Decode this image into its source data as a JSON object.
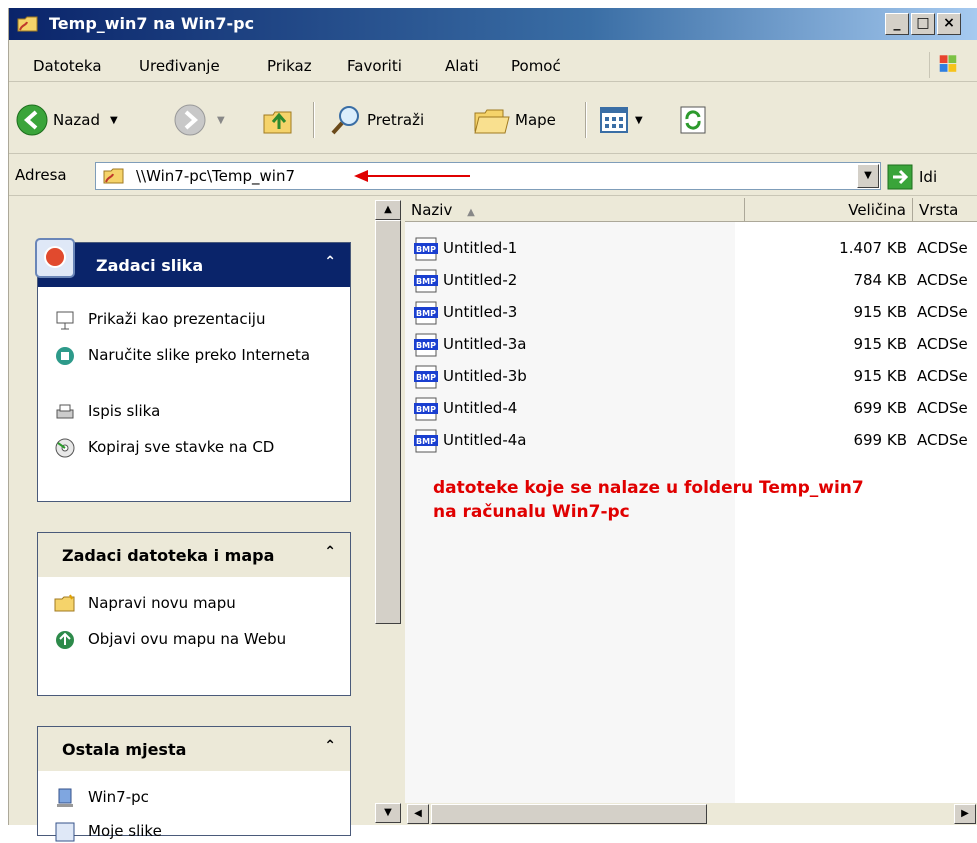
{
  "window": {
    "title": "Temp_win7 na Win7-pc"
  },
  "menu": [
    "Datoteka",
    "Uređivanje",
    "Prikaz",
    "Favoriti",
    "Alati",
    "Pomoć"
  ],
  "toolbar": {
    "back": "Nazad",
    "search": "Pretraži",
    "folders": "Mape"
  },
  "address": {
    "label": "Adresa",
    "value": "\\\\Win7-pc\\Temp_win7",
    "go": "Idi"
  },
  "panels": {
    "picture_tasks": {
      "title": "Zadaci slika",
      "items": [
        "Prikaži kao prezentaciju",
        "Naručite slike preko Interneta",
        "Ispis slika",
        "Kopiraj sve stavke na CD"
      ]
    },
    "file_tasks": {
      "title": "Zadaci datoteka i mapa",
      "items": [
        "Napravi novu mapu",
        "Objavi ovu mapu na Webu"
      ]
    },
    "other_places": {
      "title": "Ostala mjesta",
      "items": [
        "Win7-pc",
        "Moje slike"
      ]
    }
  },
  "columns": {
    "name": "Naziv",
    "size": "Veličina",
    "type": "Vrsta"
  },
  "files": [
    {
      "name": "Untitled-1",
      "size": "1.407 KB",
      "type": "ACDSe"
    },
    {
      "name": "Untitled-2",
      "size": "784 KB",
      "type": "ACDSe"
    },
    {
      "name": "Untitled-3",
      "size": "915 KB",
      "type": "ACDSe"
    },
    {
      "name": "Untitled-3a",
      "size": "915 KB",
      "type": "ACDSe"
    },
    {
      "name": "Untitled-3b",
      "size": "915 KB",
      "type": "ACDSe"
    },
    {
      "name": "Untitled-4",
      "size": "699 KB",
      "type": "ACDSe"
    },
    {
      "name": "Untitled-4a",
      "size": "699 KB",
      "type": "ACDSe"
    }
  ],
  "annotation": {
    "line1": "datoteke koje se nalaze u folderu Temp_win7",
    "line2": "na računalu Win7-pc"
  },
  "file_icon_label": "BMP",
  "colors": {
    "annotation": "#e00000",
    "title_bar": "#0a246a"
  }
}
